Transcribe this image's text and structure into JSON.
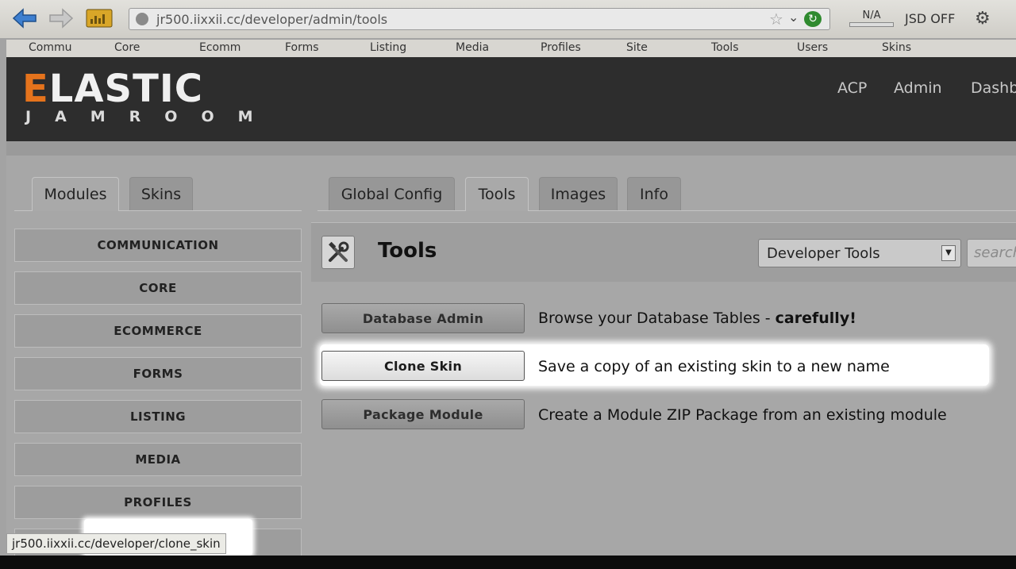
{
  "browser": {
    "url": "jr500.iixxii.cc/developer/admin/tools",
    "bandwidth_value": "N/A",
    "jsd_label": "JSD OFF"
  },
  "bookmarks": [
    "Commu",
    "Core",
    "Ecomm",
    "Forms",
    "Listing",
    "Media",
    "Profiles",
    "Site",
    "Tools",
    "Users",
    "Skins"
  ],
  "site": {
    "logo_main": "ELASTIC",
    "logo_first_letter": "E",
    "logo_rest": "LASTIC",
    "logo_sub": "JAMROOM",
    "nav": [
      "ACP",
      "Admin",
      "Dashb"
    ]
  },
  "left_tabs": [
    "Modules",
    "Skins"
  ],
  "right_tabs": [
    "Global Config",
    "Tools",
    "Images",
    "Info"
  ],
  "active_left_tab": "Modules",
  "active_right_tab": "Tools",
  "sidebar": [
    "COMMUNICATION",
    "CORE",
    "ECOMMERCE",
    "FORMS",
    "LISTING",
    "MEDIA",
    "PROFILES"
  ],
  "panel": {
    "title": "Tools",
    "select_value": "Developer Tools",
    "search_placeholder": "search"
  },
  "tools": [
    {
      "label": "Database Admin",
      "desc_pre": "Browse your Database Tables - ",
      "desc_bold": "carefully!",
      "highlighted": false
    },
    {
      "label": "Clone Skin",
      "desc_pre": "Save a copy of an existing skin to a new name",
      "desc_bold": "",
      "highlighted": true
    },
    {
      "label": "Package Module",
      "desc_pre": "Create a Module ZIP Package from an existing module",
      "desc_bold": "",
      "highlighted": false
    }
  ],
  "statusbar": {
    "text": "jr500.iixxii.cc/developer/clone_skin"
  },
  "colors": {
    "accent_orange": "#e5731c",
    "header_dark": "#2d2d2d",
    "page_gray": "#a7a7a7"
  }
}
